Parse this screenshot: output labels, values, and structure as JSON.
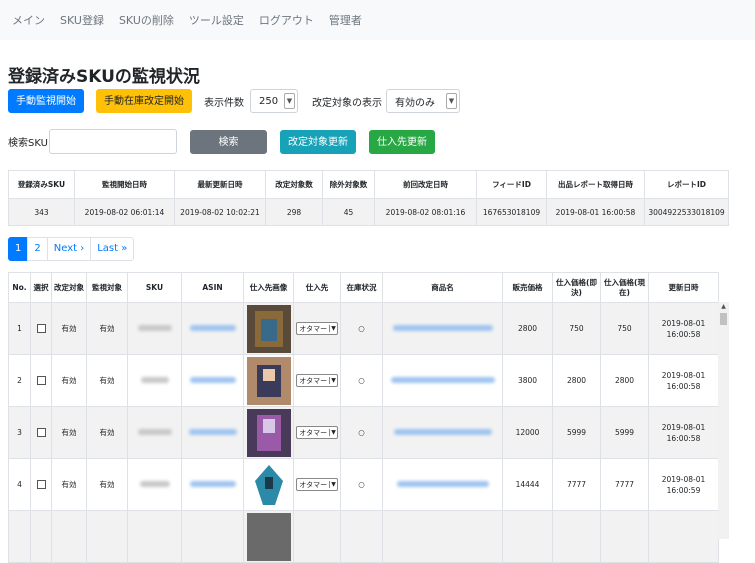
{
  "nav": [
    "メイン",
    "SKU登録",
    "SKUの削除",
    "ツール設定",
    "ログアウト",
    "管理者"
  ],
  "page_title": "登録済みSKUの監視状況",
  "toolbar": {
    "start_monitor": "手動監視開始",
    "start_stock_revise": "手動在庫改定開始",
    "display_count_label": "表示件数",
    "display_count_value": "250",
    "revise_target_label": "改定対象の表示",
    "revise_target_value": "有効のみ"
  },
  "search": {
    "label": "検索SKU",
    "value": "",
    "search_button": "検索",
    "update_revise_button": "改定対象更新",
    "update_supplier_button": "仕入先更新"
  },
  "summary": {
    "headers": [
      "登録済みSKU",
      "監視開始日時",
      "最新更新日時",
      "改定対象数",
      "除外対象数",
      "前回改定日時",
      "フィードID",
      "出品レポート取得日時",
      "レポートID"
    ],
    "values": [
      "343",
      "2019-08-02 06:01:14",
      "2019-08-02 10:02:21",
      "298",
      "45",
      "2019-08-02 08:01:16",
      "167653018109",
      "2019-08-01 16:00:58",
      "3004922533018109"
    ]
  },
  "pagination": [
    "1",
    "2",
    "Next ›",
    "Last »"
  ],
  "table": {
    "headers": [
      "No.",
      "選択",
      "改定対象",
      "監視対象",
      "SKU",
      "ASIN",
      "仕入先画像",
      "仕入先",
      "在庫状況",
      "商品名",
      "販売価格",
      "仕入価格(即決)",
      "仕入価格(現在)",
      "更新日時"
    ],
    "rows": [
      {
        "no": "1",
        "revise": "有効",
        "monitor": "有効",
        "supplier": "オタマー",
        "stock": "○",
        "price": "2800",
        "buy_now": "750",
        "current": "750",
        "updated": "2019-08-01 16:00:58"
      },
      {
        "no": "2",
        "revise": "有効",
        "monitor": "有効",
        "supplier": "オタマー",
        "stock": "○",
        "price": "3800",
        "buy_now": "2800",
        "current": "2800",
        "updated": "2019-08-01 16:00:58"
      },
      {
        "no": "3",
        "revise": "有効",
        "monitor": "有効",
        "supplier": "オタマー",
        "stock": "○",
        "price": "12000",
        "buy_now": "5999",
        "current": "5999",
        "updated": "2019-08-01 16:00:58"
      },
      {
        "no": "4",
        "revise": "有効",
        "monitor": "有効",
        "supplier": "オタマー",
        "stock": "○",
        "price": "14444",
        "buy_now": "7777",
        "current": "7777",
        "updated": "2019-08-01 16:00:59"
      }
    ]
  },
  "colors": {
    "primary": "#007bff",
    "warning": "#ffc107",
    "secondary": "#6c757d",
    "info": "#17a2b8",
    "success": "#28a745",
    "navbar_bg": "#f8f9fa"
  }
}
